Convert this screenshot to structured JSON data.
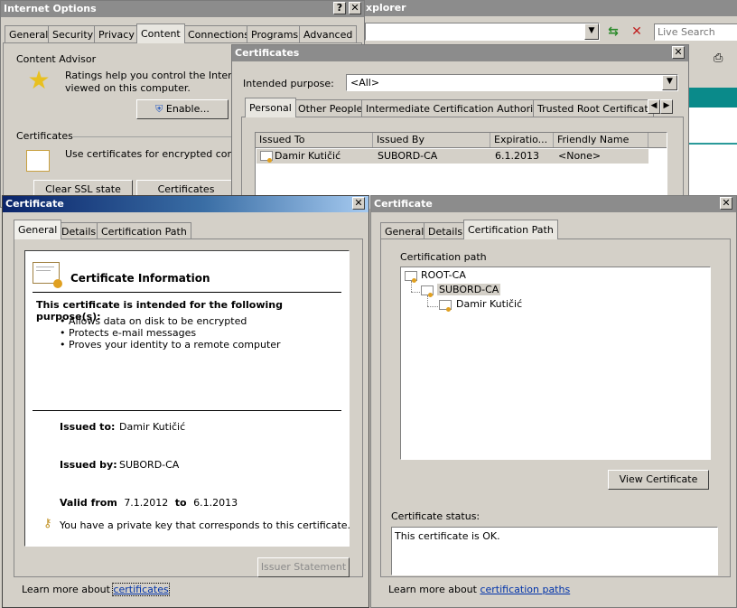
{
  "ie_window": {
    "title": "xplorer",
    "search_placeholder": "Live Search"
  },
  "internet_options": {
    "title": "Internet Options",
    "tabs": [
      "General",
      "Security",
      "Privacy",
      "Content",
      "Connections",
      "Programs",
      "Advanced"
    ],
    "content_advisor_label": "Content Advisor",
    "content_advisor_text1": "Ratings help you control the Internet c",
    "content_advisor_text2": "viewed on this computer.",
    "enable_button": "Enable...",
    "certificates_label": "Certificates",
    "certificates_text": "Use certificates for encrypted connect",
    "clear_ssl_button": "Clear SSL state",
    "certificates_button": "Certificates"
  },
  "certificates_dialog": {
    "title": "Certificates",
    "intended_purpose_label": "Intended purpose:",
    "intended_purpose_value": "<All>",
    "tabs": [
      "Personal",
      "Other People",
      "Intermediate Certification Authorities",
      "Trusted Root Certification"
    ],
    "columns": [
      "Issued To",
      "Issued By",
      "Expiratio...",
      "Friendly Name"
    ],
    "rows": [
      {
        "issued_to": "Damir Kutičić",
        "issued_by": "SUBORD-CA",
        "expiration": "6.1.2013",
        "friendly_name": "<None>"
      }
    ]
  },
  "cert_general": {
    "title": "Certificate",
    "tabs": [
      "General",
      "Details",
      "Certification Path"
    ],
    "info_title": "Certificate Information",
    "purpose_heading": "This certificate is intended for the following purpose(s):",
    "purposes": [
      "Allows data on disk to be encrypted",
      "Protects e-mail messages",
      "Proves your identity to a remote computer"
    ],
    "issued_to_label": "Issued to:",
    "issued_to_value": "Damir Kutičić",
    "issued_by_label": "Issued by:",
    "issued_by_value": "SUBORD-CA",
    "valid_from_label": "Valid from",
    "valid_from_value": "7.1.2012",
    "to_label": "to",
    "valid_to_value": "6.1.2013",
    "private_key_text": "You have a private key that corresponds to this certificate.",
    "issuer_statement_button": "Issuer Statement",
    "learn_more_text": "Learn more about",
    "learn_more_link": "certificates"
  },
  "cert_path": {
    "title": "Certificate",
    "tabs": [
      "General",
      "Details",
      "Certification Path"
    ],
    "path_label": "Certification path",
    "path_nodes": [
      "ROOT-CA",
      "SUBORD-CA",
      "Damir Kutičić"
    ],
    "view_certificate_button": "View Certificate",
    "status_label": "Certificate status:",
    "status_text": "This certificate is OK.",
    "learn_more_text": "Learn more about",
    "learn_more_link": "certification paths"
  }
}
